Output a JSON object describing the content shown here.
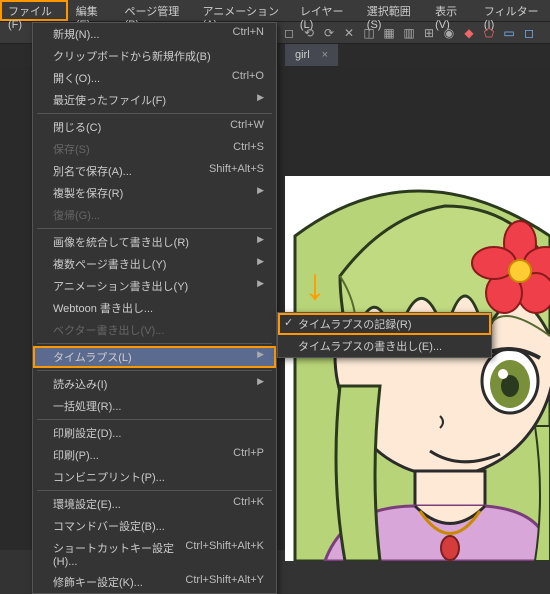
{
  "menubar": {
    "items": [
      {
        "label": "ファイル(F)",
        "active": true
      },
      {
        "label": "編集(E)"
      },
      {
        "label": "ページ管理(P)"
      },
      {
        "label": "アニメーション(A)"
      },
      {
        "label": "レイヤー(L)"
      },
      {
        "label": "選択範囲(S)"
      },
      {
        "label": "表示(V)"
      },
      {
        "label": "フィルター(I)"
      }
    ]
  },
  "tab": {
    "label": "girl",
    "close": "×"
  },
  "dropdown": {
    "groups": [
      [
        {
          "label": "新規(N)...",
          "shortcut": "Ctrl+N"
        },
        {
          "label": "クリップボードから新規作成(B)"
        },
        {
          "label": "開く(O)...",
          "shortcut": "Ctrl+O"
        },
        {
          "label": "最近使ったファイル(F)",
          "arrow": true
        }
      ],
      [
        {
          "label": "閉じる(C)",
          "shortcut": "Ctrl+W"
        },
        {
          "label": "保存(S)",
          "shortcut": "Ctrl+S",
          "disabled": true
        },
        {
          "label": "別名で保存(A)...",
          "shortcut": "Shift+Alt+S"
        },
        {
          "label": "複製を保存(R)",
          "arrow": true
        },
        {
          "label": "復帰(G)...",
          "disabled": true
        }
      ],
      [
        {
          "label": "画像を統合して書き出し(R)",
          "arrow": true
        },
        {
          "label": "複数ページ書き出し(Y)",
          "arrow": true
        },
        {
          "label": "アニメーション書き出し(Y)",
          "arrow": true
        },
        {
          "label": "Webtoon 書き出し..."
        },
        {
          "label": "ベクター書き出し(V)...",
          "disabled": true
        }
      ],
      [
        {
          "label": "タイムラプス(L)",
          "arrow": true,
          "highlighted": true
        }
      ],
      [
        {
          "label": "読み込み(I)",
          "arrow": true
        },
        {
          "label": "一括処理(R)..."
        }
      ],
      [
        {
          "label": "印刷設定(D)..."
        },
        {
          "label": "印刷(P)...",
          "shortcut": "Ctrl+P"
        },
        {
          "label": "コンビニプリント(P)..."
        }
      ],
      [
        {
          "label": "環境設定(E)...",
          "shortcut": "Ctrl+K"
        },
        {
          "label": "コマンドバー設定(B)..."
        },
        {
          "label": "ショートカットキー設定(H)...",
          "shortcut": "Ctrl+Shift+Alt+K"
        },
        {
          "label": "修飾キー設定(K)...",
          "shortcut": "Ctrl+Shift+Alt+Y"
        }
      ]
    ]
  },
  "submenu": {
    "items": [
      {
        "label": "タイムラプスの記録(R)",
        "checked": true,
        "highlighted": true
      },
      {
        "label": "タイムラプスの書き出し(E)..."
      }
    ]
  }
}
